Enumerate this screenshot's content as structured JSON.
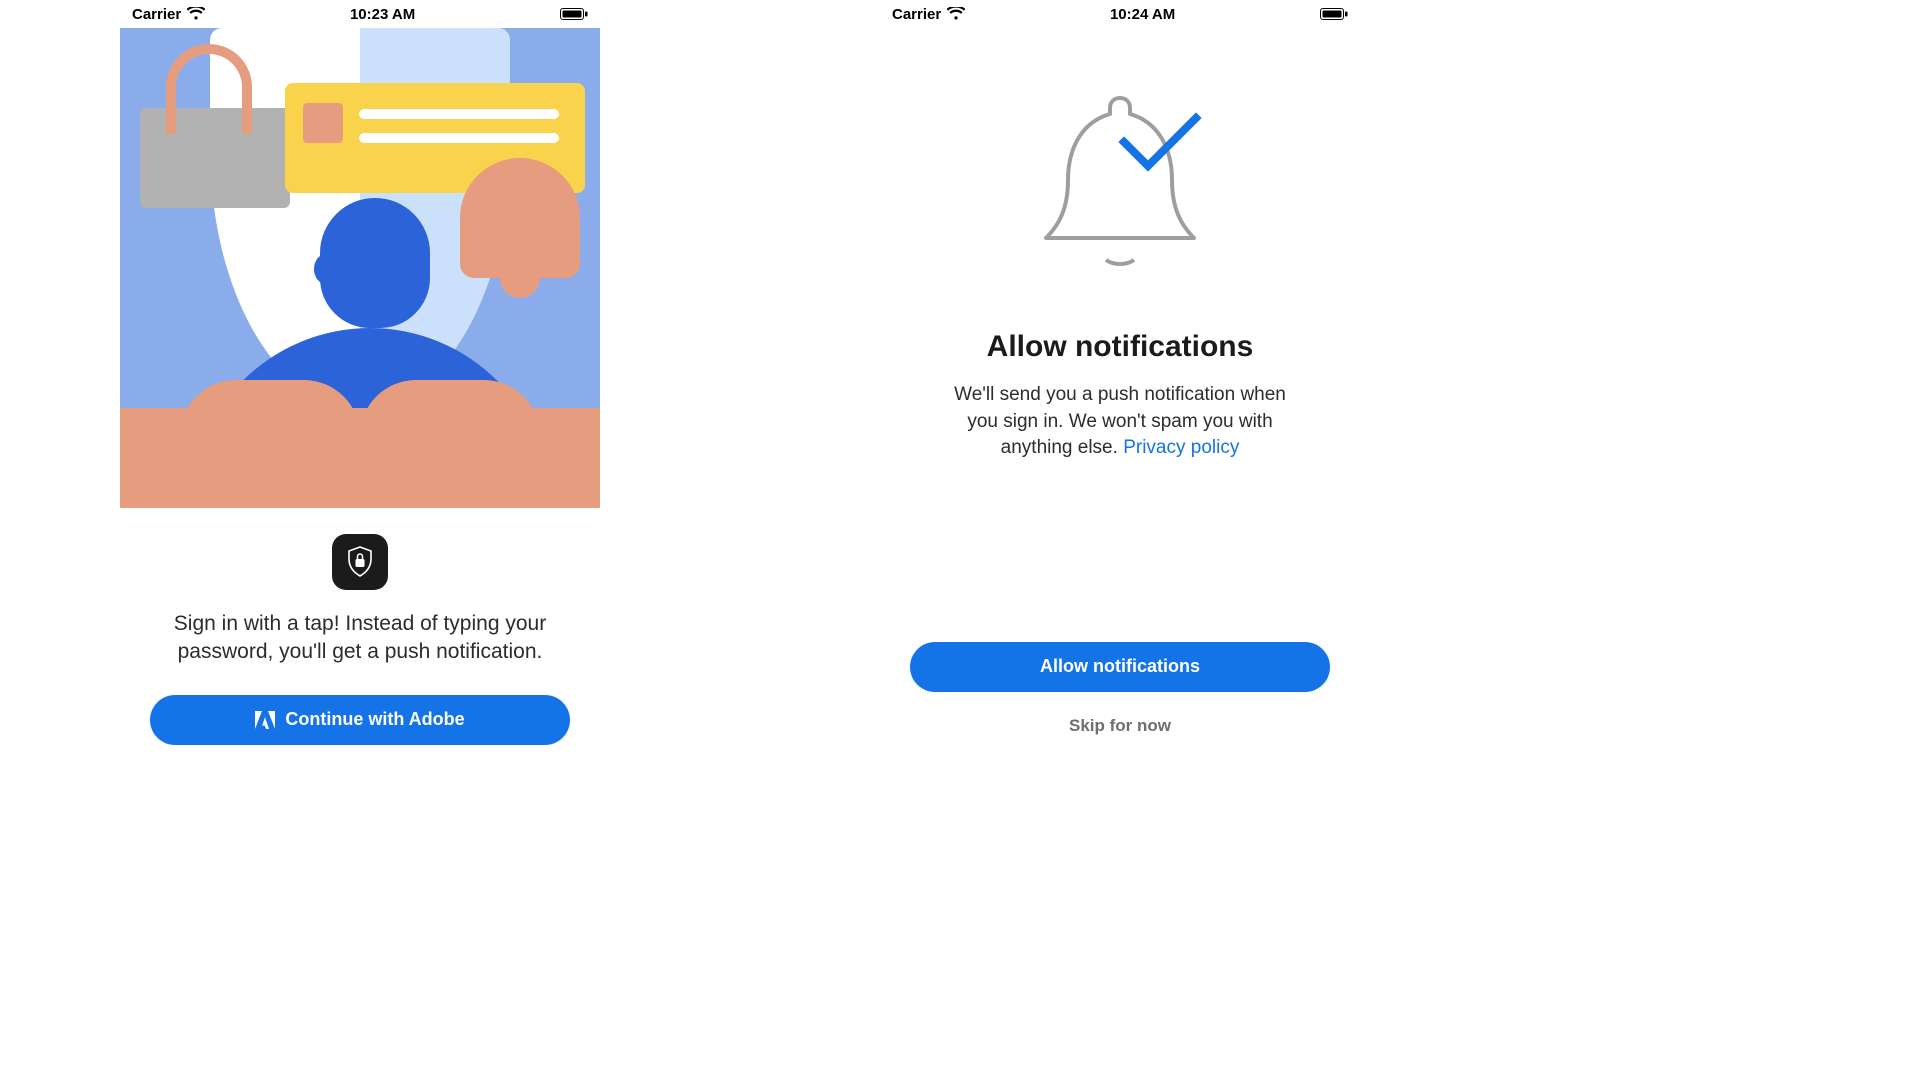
{
  "screen1": {
    "status": {
      "carrier": "Carrier",
      "time": "10:23 AM"
    },
    "blurb": "Sign in with a tap! Instead of typing your password, you'll get a push notification.",
    "cta": "Continue with Adobe"
  },
  "screen2": {
    "status": {
      "carrier": "Carrier",
      "time": "10:24 AM"
    },
    "title": "Allow notifications",
    "subtitle": "We'll send you a push notification when you sign in. We won't spam you with anything else.",
    "privacy_label": "Privacy policy",
    "cta": "Allow notifications",
    "skip": "Skip for now"
  }
}
